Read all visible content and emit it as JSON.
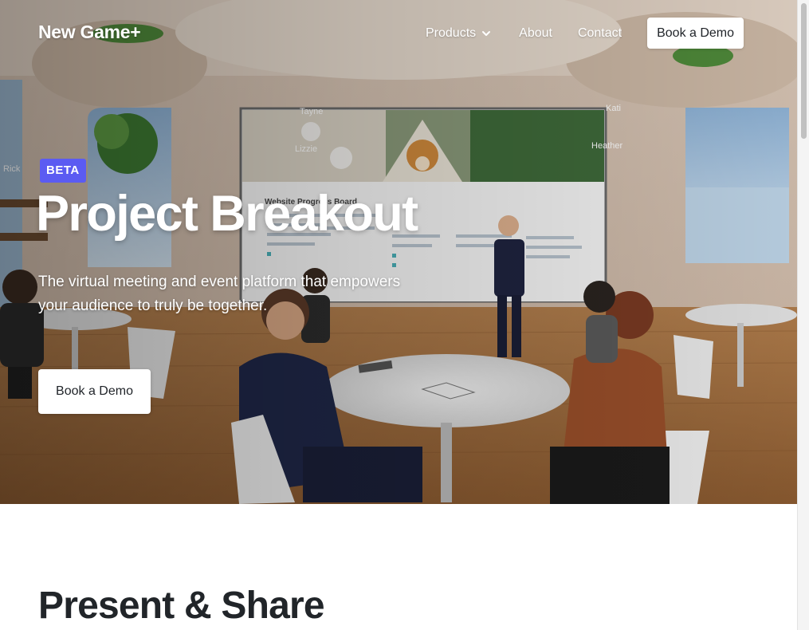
{
  "nav": {
    "brand": "New Game+",
    "links": [
      {
        "label": "Products",
        "has_dropdown": true
      },
      {
        "label": "About"
      },
      {
        "label": "Contact"
      }
    ],
    "cta_label": "Book a Demo"
  },
  "hero": {
    "badge": "BETA",
    "title": "Project Breakout",
    "subtitle": "The virtual meeting and event platform that empowers your audience to truly be together.",
    "cta_label": "Book a Demo",
    "scene_labels": {
      "tayne": "Tayne",
      "kati": "Kati",
      "lizzie": "Lizzie",
      "heather": "Heather",
      "rick": "Rick",
      "board_title": "Website Progress Board"
    }
  },
  "section": {
    "title": "Present & Share"
  },
  "colors": {
    "badge": "#5b5bf2",
    "button_bg": "#ffffff",
    "heading_dark": "#212529"
  }
}
